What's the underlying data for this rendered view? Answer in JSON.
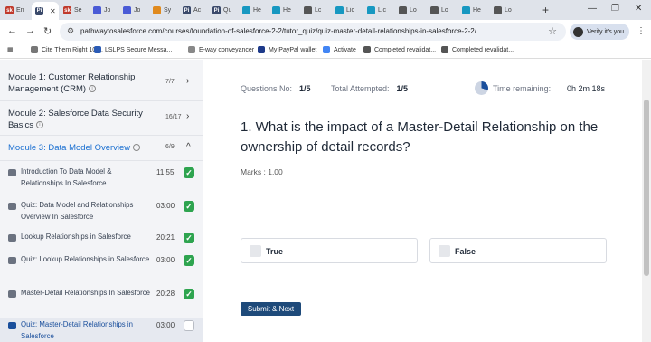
{
  "browser": {
    "tabs": [
      {
        "label": "En",
        "fav": "sk",
        "color": "#c0392b"
      },
      {
        "label": "",
        "fav": "Pi",
        "color": "#3b4a6b",
        "active": true
      },
      {
        "label": "Se",
        "fav": "sk",
        "color": "#c0392b"
      },
      {
        "label": "Jo",
        "fav": "",
        "color": "#4a5bd6"
      },
      {
        "label": "Jo",
        "fav": "",
        "color": "#4a5bd6"
      },
      {
        "label": "Sy",
        "fav": "",
        "color": "#e08a1e"
      },
      {
        "label": "Ac",
        "fav": "Pi",
        "color": "#3b4a6b"
      },
      {
        "label": "Qu",
        "fav": "Pi",
        "color": "#3b4a6b"
      },
      {
        "label": "He",
        "fav": "",
        "color": "#1798c1"
      },
      {
        "label": "He",
        "fav": "",
        "color": "#1798c1"
      },
      {
        "label": "Lc",
        "fav": "",
        "color": "#555"
      },
      {
        "label": "Lic",
        "fav": "",
        "color": "#1798c1"
      },
      {
        "label": "Lic",
        "fav": "",
        "color": "#1798c1"
      },
      {
        "label": "Lo",
        "fav": "",
        "color": "#555"
      },
      {
        "label": "Lo",
        "fav": "",
        "color": "#555"
      },
      {
        "label": "He",
        "fav": "",
        "color": "#1798c1"
      },
      {
        "label": "Lo",
        "fav": "",
        "color": "#555"
      }
    ],
    "url": "pathwaytosalesforce.com/courses/foundation-of-salesforce-2-2/tutor_quiz/quiz-master-detail-relationships-in-salesforce-2-2/",
    "verify_label": "Verify it's you",
    "bookmarks": [
      "Cite Them Right 10t...",
      "LSLPS Secure Messa...",
      "E-way conveyancer",
      "My PayPal wallet",
      "Activate",
      "Completed revalidat...",
      "Completed revalidat..."
    ]
  },
  "sidebar": {
    "modules": [
      {
        "title": "Module 1: Customer Relationship Management (CRM)",
        "count": "7/7",
        "chevron": "›"
      },
      {
        "title": "Module 2: Salesforce Data Security Basics",
        "count": "16/17",
        "chevron": "›"
      },
      {
        "title": "Module 3: Data Model Overview",
        "count": "6/9",
        "chevron": "^"
      }
    ],
    "lessons": [
      {
        "title": "Introduction To Data Model & Relationships In Salesforce",
        "time": "11:55",
        "done": true,
        "type": "video"
      },
      {
        "title": "Quiz: Data Model and Relationships Overview In Salesforce",
        "time": "03:00",
        "done": true,
        "type": "quiz"
      },
      {
        "title": "Lookup Relationships in Salesforce",
        "time": "20:21",
        "done": true,
        "type": "video"
      },
      {
        "title": "Quiz: Lookup Relationships in Salesforce",
        "time": "03:00",
        "done": true,
        "type": "quiz"
      },
      {
        "title": "Master-Detail Relationships In Salesforce",
        "time": "20:28",
        "done": true,
        "type": "video"
      },
      {
        "title": "Quiz: Master-Detail Relationships in Salesforce",
        "time": "03:00",
        "done": false,
        "type": "quiz"
      }
    ]
  },
  "quiz": {
    "questions_no_label": "Questions No:",
    "questions_no_value": "1/5",
    "attempted_label": "Total Attempted:",
    "attempted_value": "1/5",
    "time_label": "Time remaining:",
    "time_value": "0h 2m 18s",
    "question": "1. What is the impact of a Master-Detail Relationship on the ownership of detail records?",
    "marks": "Marks : 1.00",
    "options": [
      "True",
      "False"
    ],
    "submit_label": "Submit & Next"
  },
  "colors": {
    "accent": "#1a6fd1",
    "check": "#2ea44f",
    "button": "#1e4a7a"
  }
}
